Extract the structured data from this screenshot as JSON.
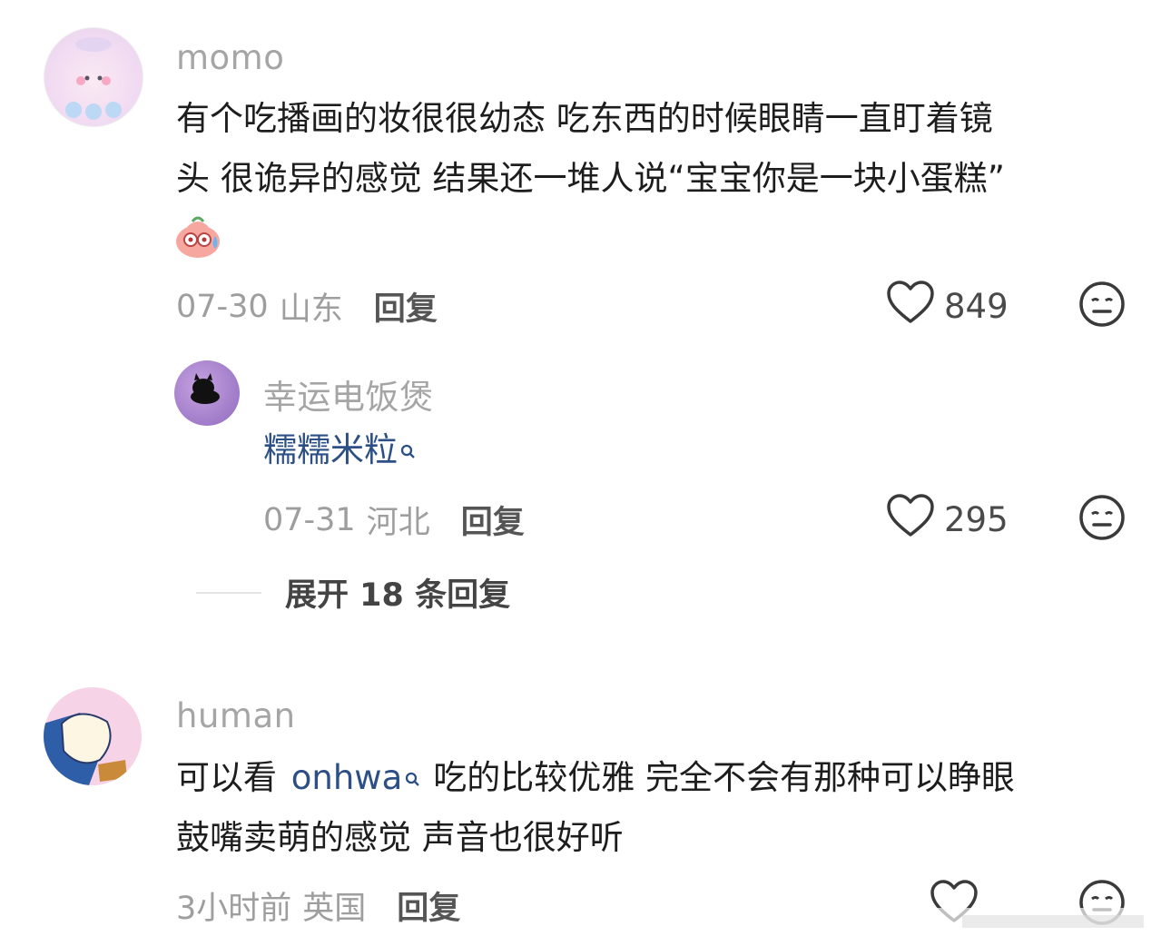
{
  "comments": [
    {
      "username": "momo",
      "text_line1": "有个吃播画的妆很很幼态 吃东西的时候眼睛一直盯着镜",
      "text_line2": "头 很诡异的感觉 结果还一堆人说“宝宝你是一块小蛋糕”",
      "emoji": "sweat-face-emoji",
      "date": "07-30",
      "location": "山东",
      "reply_label": "回复",
      "likes": "849"
    },
    {
      "username": "幸运电饭煲",
      "text_link": "糯糯米粒",
      "date": "07-31",
      "location": "河北",
      "reply_label": "回复",
      "likes": "295"
    },
    {
      "username": "human",
      "text_prefix": "可以看",
      "text_link": "onhwa",
      "text_suffix": "吃的比较优雅 完全不会有那种可以睁眼",
      "text_line2": "鼓嘴卖萌的感觉 声音也很好听",
      "date": "3小时前",
      "location": "英国",
      "reply_label": "回复"
    }
  ],
  "expand_replies": "展开 18 条回复",
  "icons": {
    "like": "heart-outline-icon",
    "reaction": "neutral-face-icon",
    "search": "search-icon"
  },
  "colors": {
    "link": "#2c4f86",
    "muted": "#9e9e9e",
    "username": "#a5a5a5"
  }
}
